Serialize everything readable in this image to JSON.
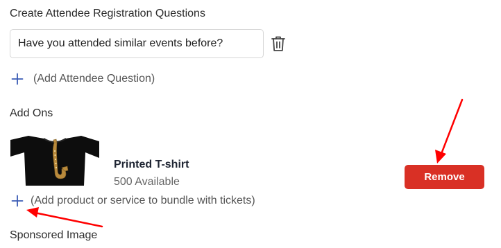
{
  "registration": {
    "heading": "Create Attendee Registration Questions",
    "question_value": "Have you attended similar events before?",
    "delete_icon": "trash-icon",
    "add_question_label": "(Add Attendee Question)"
  },
  "addons": {
    "heading": "Add Ons",
    "product": {
      "name": "Printed T-shirt",
      "availability": "500 Available",
      "image_icon": "tshirt-saxophone-image"
    },
    "remove_label": "Remove",
    "add_product_label": "(Add product or service to bundle with tickets)"
  },
  "sponsored": {
    "heading": "Sponsored Image"
  },
  "colors": {
    "accent_blue": "#3a5bb5",
    "remove_red": "#d93025",
    "annotation_red": "#ff0000"
  }
}
